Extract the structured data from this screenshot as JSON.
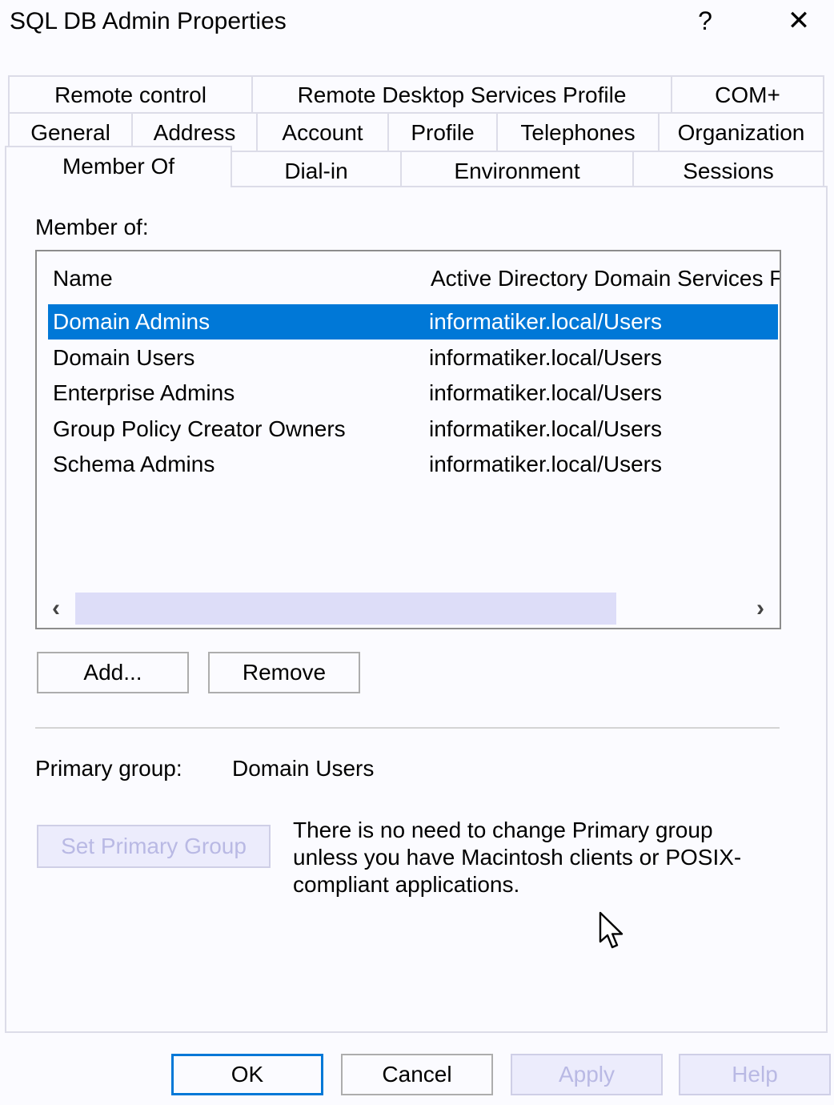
{
  "window": {
    "title": "SQL DB Admin Properties",
    "help_glyph": "?",
    "close_glyph": "✕"
  },
  "tabs": {
    "row1": [
      "Remote control",
      "Remote Desktop Services Profile",
      "COM+"
    ],
    "row2": [
      "General",
      "Address",
      "Account",
      "Profile",
      "Telephones",
      "Organization"
    ],
    "row3": [
      "Member Of",
      "Dial-in",
      "Environment",
      "Sessions"
    ],
    "active": "Member Of"
  },
  "member_of": {
    "label": "Member of:",
    "columns": [
      "Name",
      "Active Directory Domain Services F"
    ],
    "rows": [
      {
        "name": "Domain Admins",
        "folder": "informatiker.local/Users",
        "selected": true
      },
      {
        "name": "Domain Users",
        "folder": "informatiker.local/Users",
        "selected": false
      },
      {
        "name": "Enterprise Admins",
        "folder": "informatiker.local/Users",
        "selected": false
      },
      {
        "name": "Group Policy Creator Owners",
        "folder": "informatiker.local/Users",
        "selected": false
      },
      {
        "name": "Schema Admins",
        "folder": "informatiker.local/Users",
        "selected": false
      }
    ],
    "scroll_left": "‹",
    "scroll_right": "›"
  },
  "actions": {
    "add": "Add...",
    "remove": "Remove"
  },
  "primary_group": {
    "label": "Primary group:",
    "value": "Domain Users",
    "set_button": "Set Primary Group",
    "note": "There is no need to change Primary group unless you have Macintosh clients or POSIX-compliant applications."
  },
  "footer": {
    "ok": "OK",
    "cancel": "Cancel",
    "apply": "Apply",
    "help": "Help"
  },
  "colors": {
    "selection": "#0078d7",
    "disabled_text": "#b9b9e4"
  }
}
